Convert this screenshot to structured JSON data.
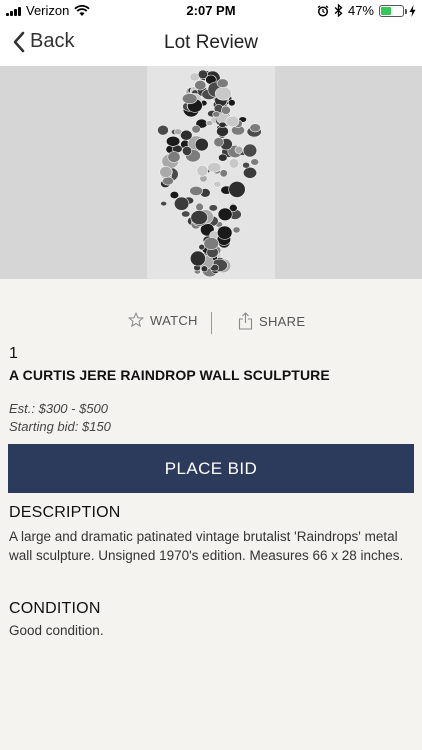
{
  "status_bar": {
    "carrier": "Verizon",
    "time": "2:07 PM",
    "battery_percent": "47%",
    "battery_level": 0.47,
    "icons": [
      "signal-icon",
      "wifi-icon",
      "alarm-icon",
      "bluetooth-icon",
      "battery-icon",
      "charging-icon"
    ]
  },
  "nav": {
    "back_label": "Back",
    "title": "Lot Review"
  },
  "lot": {
    "number": "1",
    "title": "A CURTIS JERE RAINDROP WALL SCULPTURE",
    "estimate": "Est.: $300 - $500",
    "starting_bid": "Starting bid: $150"
  },
  "actions": {
    "watch_label": "WATCH",
    "share_label": "SHARE"
  },
  "place_bid_label": "PLACE BID",
  "description": {
    "heading": "DESCRIPTION",
    "body": "A large and dramatic patinated vintage brutalist 'Raindrops' metal wall sculpture. Unsigned 1970's edition. Measures 66 x 28 inches."
  },
  "condition": {
    "heading": "CONDITION",
    "body": "Good condition."
  },
  "colors": {
    "button_bg": "#2c3a5c",
    "page_bg": "#f4f3ef",
    "battery": "#35c759"
  }
}
